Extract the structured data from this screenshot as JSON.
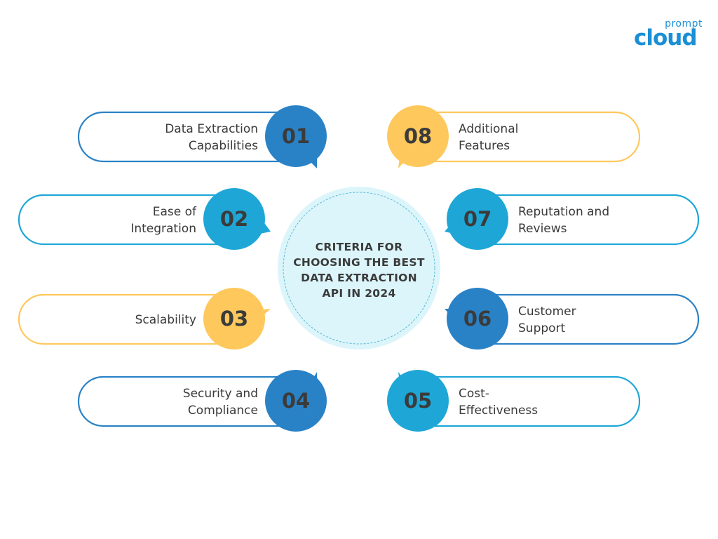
{
  "logo": {
    "top": "prompt",
    "bottom": "cloud"
  },
  "center": {
    "lines": [
      "CRITERIA FOR",
      "CHOOSING THE BEST",
      "DATA EXTRACTION",
      "API IN 2024"
    ]
  },
  "colors": {
    "dark_blue": "#2a82c6",
    "light_blue": "#1ea7d6",
    "yellow": "#fec85c",
    "center_fill": "#dcf5fb"
  },
  "items": [
    {
      "number": "01",
      "lines": [
        "Data Extraction",
        "Capabilities"
      ],
      "color": "#2a82c6",
      "side": "left"
    },
    {
      "number": "02",
      "lines": [
        "Ease of",
        "Integration"
      ],
      "color": "#1ea7d6",
      "side": "left"
    },
    {
      "number": "03",
      "lines": [
        "Scalability"
      ],
      "color": "#fec85c",
      "side": "left"
    },
    {
      "number": "04",
      "lines": [
        "Security and",
        "Compliance"
      ],
      "color": "#2a82c6",
      "side": "left"
    },
    {
      "number": "05",
      "lines": [
        "Cost-",
        "Effectiveness"
      ],
      "color": "#1ea7d6",
      "side": "right"
    },
    {
      "number": "06",
      "lines": [
        "Customer",
        "Support"
      ],
      "color": "#2a82c6",
      "side": "right"
    },
    {
      "number": "07",
      "lines": [
        "Reputation and",
        "Reviews"
      ],
      "color": "#1ea7d6",
      "side": "right"
    },
    {
      "number": "08",
      "lines": [
        "Additional",
        "Features"
      ],
      "color": "#fec85c",
      "side": "right"
    }
  ]
}
